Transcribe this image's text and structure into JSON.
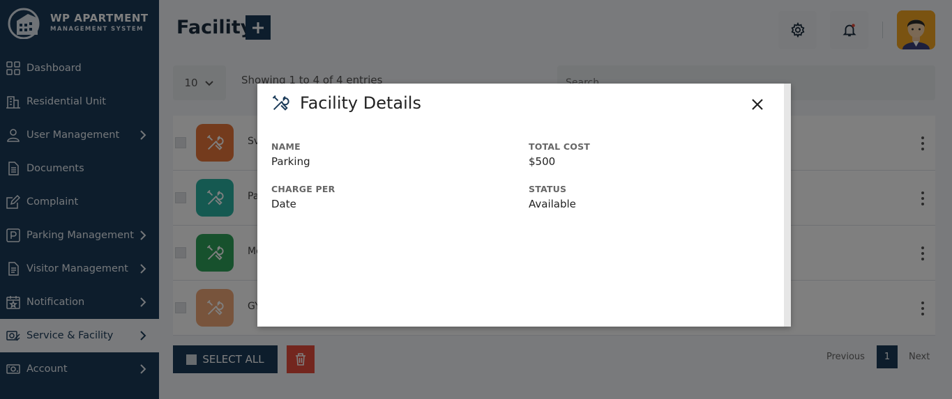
{
  "app": {
    "logo_title": "WP APARTMENT",
    "logo_subtitle": "MANAGEMENT SYSTEM"
  },
  "sidebar": {
    "items": [
      {
        "label": "Dashboard",
        "icon": "grid-icon",
        "has_chevron": false
      },
      {
        "label": "Residential Unit",
        "icon": "building-icon",
        "has_chevron": false
      },
      {
        "label": "User Management",
        "icon": "user-icon",
        "has_chevron": true
      },
      {
        "label": "Documents",
        "icon": "document-icon",
        "has_chevron": false
      },
      {
        "label": "Complaint",
        "icon": "edit-icon",
        "has_chevron": false
      },
      {
        "label": "Parking Management",
        "icon": "parking-icon",
        "has_chevron": true
      },
      {
        "label": "Visitor Management",
        "icon": "clipboard-icon",
        "has_chevron": true
      },
      {
        "label": "Notification",
        "icon": "calendar-star-icon",
        "has_chevron": true
      },
      {
        "label": "Service & Facility",
        "icon": "service-icon",
        "has_chevron": true,
        "active": true
      },
      {
        "label": "Account",
        "icon": "money-icon",
        "has_chevron": true
      }
    ]
  },
  "header": {
    "title": "Facility"
  },
  "table": {
    "page_size": "10",
    "showing_text": "Showing 1 to 4 of 4 entries",
    "search_placeholder": "Search",
    "rows": [
      {
        "name": "Sv",
        "color": "#e8763a"
      },
      {
        "name": "Pa",
        "color": "#2bb3a3"
      },
      {
        "name": "Mo",
        "color": "#2fa35a"
      },
      {
        "name": "GY",
        "color": "#f0a878"
      }
    ],
    "select_all_label": "SELECT ALL",
    "pagination": {
      "previous": "Previous",
      "current": "1",
      "next": "Next"
    }
  },
  "modal": {
    "title": "Facility Details",
    "fields": {
      "name_label": "NAME",
      "name_value": "Parking",
      "total_cost_label": "TOTAL COST",
      "total_cost_value": "$500",
      "charge_per_label": "CHARGE PER",
      "charge_per_value": "Date",
      "status_label": "STATUS",
      "status_value": "Available"
    }
  },
  "colors": {
    "primary": "#1b3b59",
    "danger": "#e74c3c"
  }
}
